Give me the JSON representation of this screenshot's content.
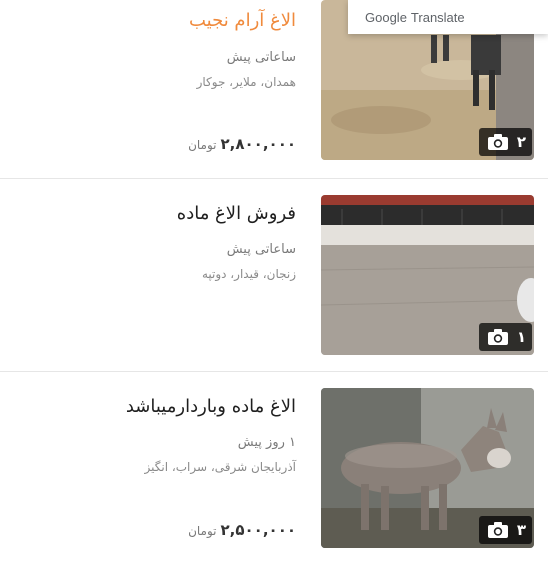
{
  "translate_popup": {
    "google": "Google",
    "translate": "Translate"
  },
  "listings": [
    {
      "title": "الاغ آرام نجیب",
      "title_color": "#f08a3c",
      "time": "ساعاتی پیش",
      "location": "همدان، ملایر، جوکار",
      "price": "۲,۸۰۰,۰۰۰",
      "price_unit": "تومان",
      "photo_count": "۲",
      "camera_icon": "camera-icon"
    },
    {
      "title": "فروش الاغ ماده",
      "title_color": "#1f1f1f",
      "time": "ساعاتی پیش",
      "location": "زنجان، قیدار، دوتپه",
      "photo_count": "۱",
      "camera_icon": "camera-icon"
    },
    {
      "title": "الاغ ماده وباردارمیباشد",
      "title_color": "#1f1f1f",
      "time": "۱ روز پیش",
      "location": "آذربایجان شرقی، سراب، انگیز",
      "price": "۲,۵۰۰,۰۰۰",
      "price_unit": "تومان",
      "photo_count": "۳",
      "camera_icon": "camera-icon"
    }
  ]
}
